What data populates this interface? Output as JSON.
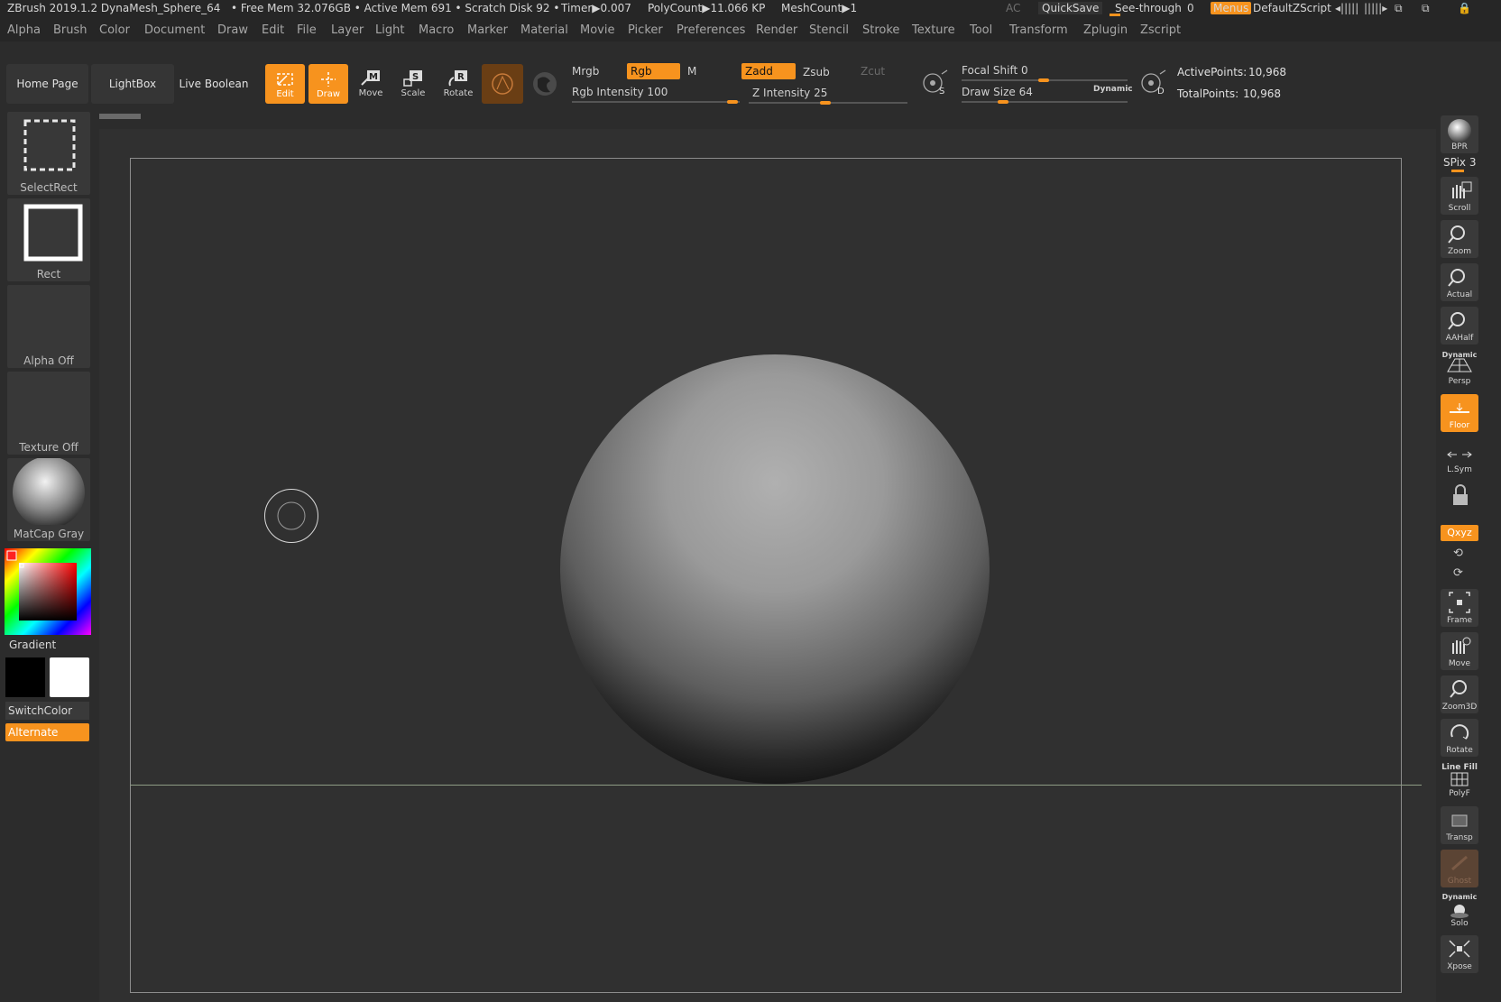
{
  "titlebar": {
    "app": "ZBrush 2019.1.2 DynaMesh_Sphere_64",
    "stats": "• Free Mem 32.076GB • Active Mem 691 • Scratch Disk 92 •",
    "timer": "Timer▶0.007",
    "polycount": "PolyCount▶11.066 KP",
    "meshcount": "MeshCount▶1",
    "ac": "AC",
    "quicksave": "QuickSave",
    "see_through": "See-through",
    "see_through_value": "0",
    "menus": "Menus",
    "script": "DefaultZScript"
  },
  "menu": [
    "Alpha",
    "Brush",
    "Color",
    "Document",
    "Draw",
    "Edit",
    "File",
    "Layer",
    "Light",
    "Macro",
    "Marker",
    "Material",
    "Movie",
    "Picker",
    "Preferences",
    "Render",
    "Stencil",
    "Stroke",
    "Texture",
    "Tool",
    "Transform",
    "Zplugin",
    "Zscript"
  ],
  "toolbar": {
    "home_page": "Home Page",
    "lightbox": "LightBox",
    "live_boolean": "Live Boolean",
    "edit": "Edit",
    "draw": "Draw",
    "move": "Move",
    "scale": "Scale",
    "rotate": "Rotate",
    "mrgb": "Mrgb",
    "rgb": "Rgb",
    "m": "M",
    "rgb_intensity": "Rgb Intensity 100",
    "zadd": "Zadd",
    "zsub": "Zsub",
    "zcut": "Zcut",
    "z_intensity": "Z Intensity 25",
    "focal_shift": "Focal Shift 0",
    "draw_size": "Draw Size 64",
    "dynamic": "Dynamic",
    "active_points_label": "ActivePoints:",
    "active_points": "10,968",
    "total_points_label": "TotalPoints:",
    "total_points": "10,968"
  },
  "left": {
    "select_rect": "SelectRect",
    "rect": "Rect",
    "alpha_off": "Alpha Off",
    "texture_off": "Texture Off",
    "matcap": "MatCap Gray",
    "gradient": "Gradient",
    "switch_color": "SwitchColor",
    "alternate": "Alternate"
  },
  "right": {
    "bpr": "BPR",
    "spix": "SPix 3",
    "scroll": "Scroll",
    "zoom": "Zoom",
    "actual": "Actual",
    "aahalf": "AAHalf",
    "persp_dynamic": "Dynamic",
    "persp": "Persp",
    "floor": "Floor",
    "lsym": "L.Sym",
    "xyz": "Qxyz",
    "frame": "Frame",
    "move": "Move",
    "zoom3d": "Zoom3D",
    "rotate": "Rotate",
    "line_fill": "Line Fill",
    "polyf": "PolyF",
    "transp": "Transp",
    "ghost": "Ghost",
    "solo_dynamic": "Dynamic",
    "solo": "Solo",
    "xpose": "Xpose"
  },
  "colors": {
    "accent": "#f7931e",
    "bg": "#303030",
    "panel": "#2c2c2c"
  }
}
